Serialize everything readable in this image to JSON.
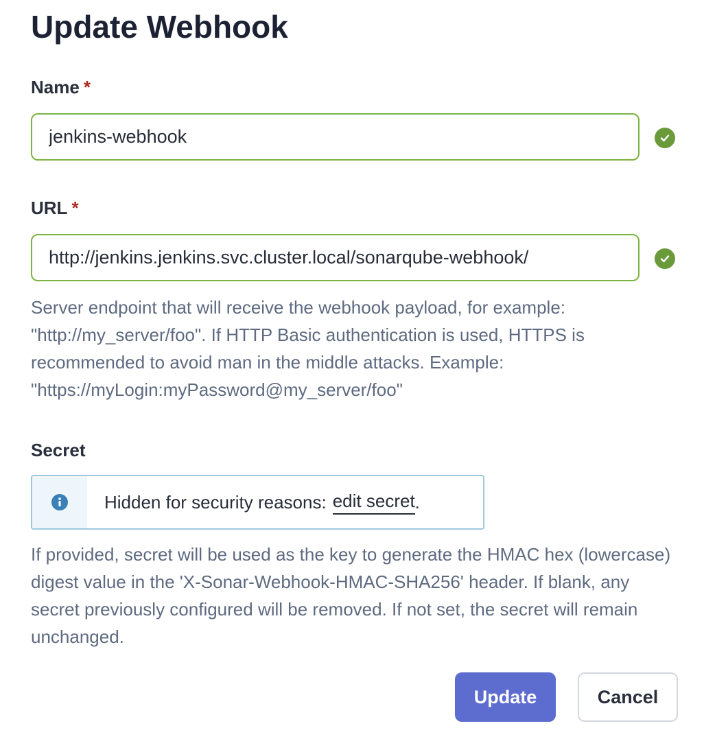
{
  "dialog": {
    "title": "Update Webhook"
  },
  "form": {
    "name": {
      "label": "Name",
      "required_marker": "*",
      "value": "jenkins-webhook"
    },
    "url": {
      "label": "URL",
      "required_marker": "*",
      "value": "http://jenkins.jenkins.svc.cluster.local/sonarqube-webhook/",
      "help": "Server endpoint that will receive the webhook payload, for example: \"http://my_server/foo\". If HTTP Basic authentication is used, HTTPS is recommended to avoid man in the middle attacks. Example: \"https://myLogin:myPassword@my_server/foo\""
    },
    "secret": {
      "label": "Secret",
      "notice_text": "Hidden for security reasons:",
      "edit_link": "edit secret",
      "notice_suffix": ".",
      "help": "If provided, secret will be used as the key to generate the HMAC hex (lowercase) digest value in the 'X-Sonar-Webhook-HMAC-SHA256' header. If blank, any secret previously configured will be removed. If not set, the secret will remain unchanged."
    }
  },
  "actions": {
    "update_label": "Update",
    "cancel_label": "Cancel"
  },
  "colors": {
    "valid": "#6a9a3a",
    "valid_border": "#7cb342",
    "required": "#b0271f",
    "primary_button": "#5d6ccf",
    "info": "#3a80b8"
  },
  "icons": {
    "valid": "check-circle-icon",
    "info": "info-circle-icon"
  }
}
